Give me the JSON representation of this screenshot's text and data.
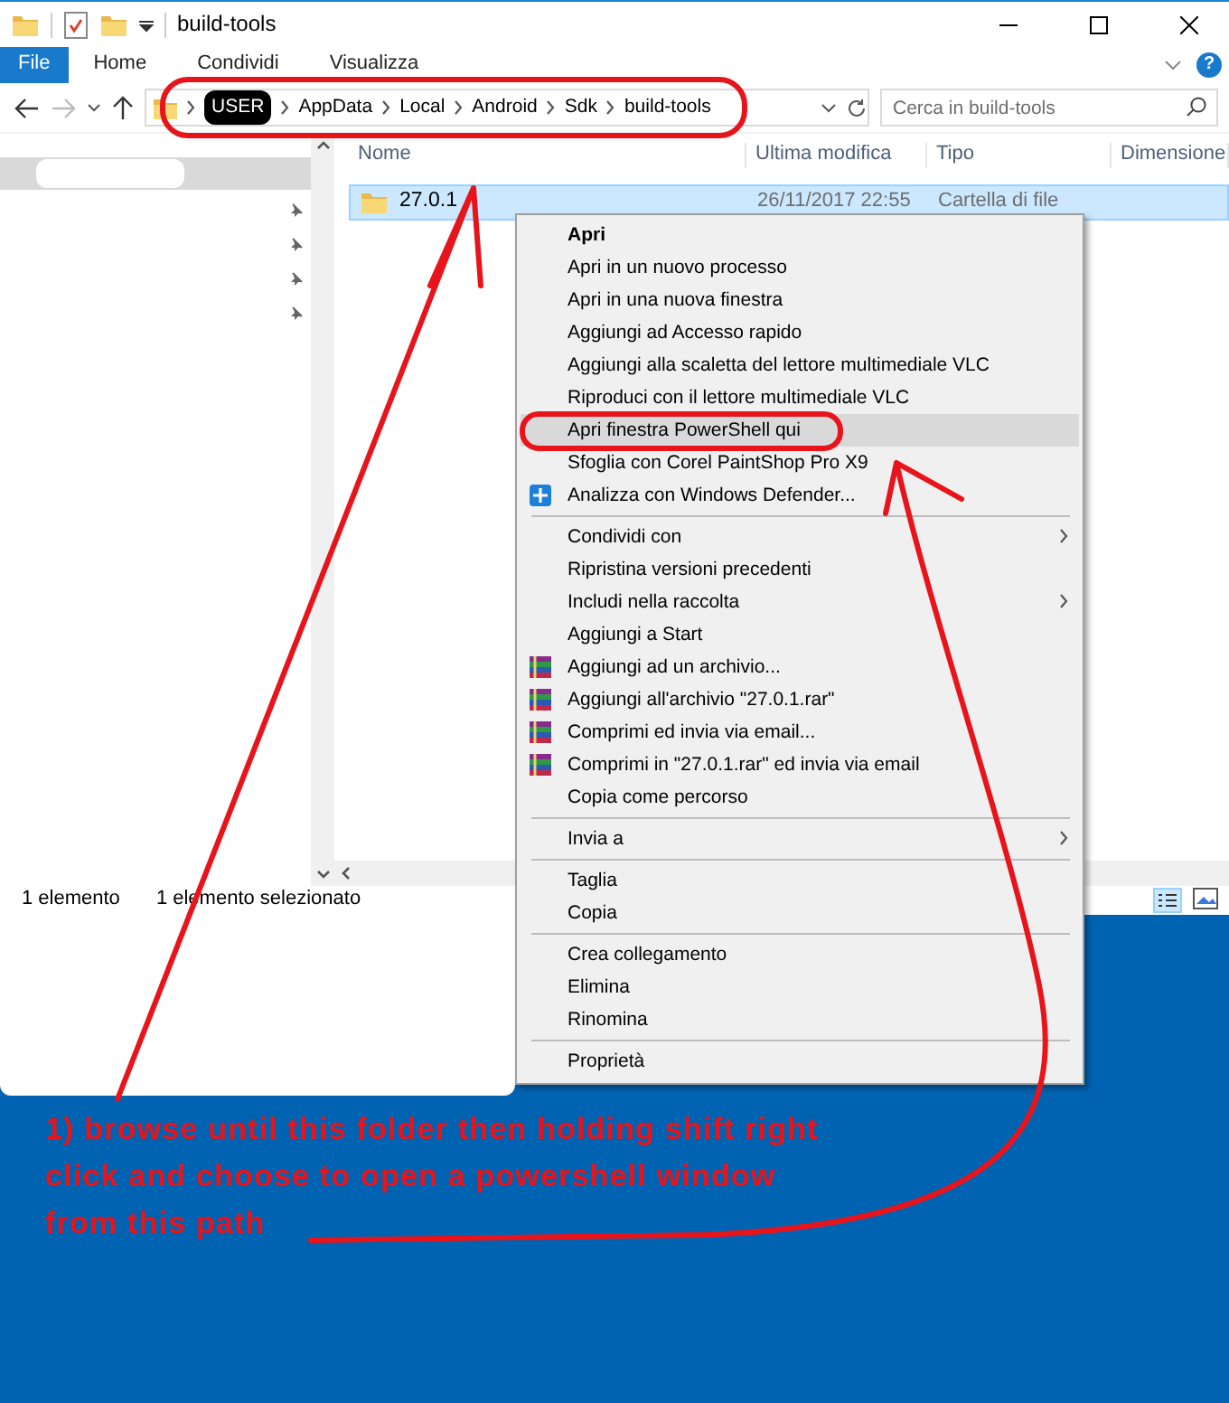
{
  "window": {
    "title": "build-tools"
  },
  "ribbon": {
    "tabs": [
      {
        "label": "File",
        "kind": "file"
      },
      {
        "label": "Home",
        "kind": "tab"
      },
      {
        "label": "Condividi",
        "kind": "tab"
      },
      {
        "label": "Visualizza",
        "kind": "tab"
      }
    ],
    "help": "?"
  },
  "address_bar": {
    "breadcrumbs": [
      {
        "label": "USER",
        "redacted": true
      },
      {
        "label": "AppData",
        "redacted": false
      },
      {
        "label": "Local",
        "redacted": false
      },
      {
        "label": "Android",
        "redacted": false
      },
      {
        "label": "Sdk",
        "redacted": false
      },
      {
        "label": "build-tools",
        "redacted": false
      }
    ]
  },
  "search": {
    "placeholder": "Cerca in build-tools"
  },
  "file_list": {
    "columns": [
      "Nome",
      "Ultima modifica",
      "Tipo",
      "Dimensione"
    ],
    "rows": [
      {
        "name": "27.0.1",
        "modified": "26/11/2017 22:55",
        "type": "Cartella di file",
        "selected": true
      }
    ]
  },
  "status_bar": [
    "1 elemento",
    "1 elemento selezionato"
  ],
  "context_menu": {
    "items": [
      {
        "label": "Apri",
        "kind": "default",
        "selected": false
      },
      {
        "label": "Apri in un nuovo processo",
        "kind": "plain",
        "selected": false
      },
      {
        "label": "Apri in una nuova finestra",
        "kind": "plain",
        "selected": false
      },
      {
        "label": "Aggiungi ad Accesso rapido",
        "kind": "plain",
        "selected": false
      },
      {
        "label": "Aggiungi alla scaletta del lettore multimediale VLC",
        "kind": "plain",
        "selected": false
      },
      {
        "label": "Riproduci con il lettore multimediale VLC",
        "kind": "plain",
        "selected": false
      },
      {
        "label": "Apri finestra PowerShell qui",
        "kind": "plain",
        "selected": true
      },
      {
        "label": "Sfoglia con Corel PaintShop Pro X9",
        "kind": "plain",
        "selected": false
      },
      {
        "label": "Analizza con Windows Defender...",
        "kind": "defender",
        "selected": false
      },
      {
        "kind": "separator"
      },
      {
        "label": "Condividi con",
        "kind": "submenu",
        "selected": false
      },
      {
        "label": "Ripristina versioni precedenti",
        "kind": "plain",
        "selected": false
      },
      {
        "label": "Includi nella raccolta",
        "kind": "submenu",
        "selected": false
      },
      {
        "label": "Aggiungi a Start",
        "kind": "plain",
        "selected": false
      },
      {
        "label": "Aggiungi ad un archivio...",
        "kind": "archive",
        "selected": false
      },
      {
        "label": "Aggiungi all'archivio \"27.0.1.rar\"",
        "kind": "archive",
        "selected": false
      },
      {
        "label": "Comprimi ed invia via email...",
        "kind": "archive",
        "selected": false
      },
      {
        "label": "Comprimi in \"27.0.1.rar\" ed invia via email",
        "kind": "archive",
        "selected": false
      },
      {
        "label": "Copia come percorso",
        "kind": "plain",
        "selected": false
      },
      {
        "kind": "separator"
      },
      {
        "label": "Invia a",
        "kind": "submenu",
        "selected": false
      },
      {
        "kind": "separator"
      },
      {
        "label": "Taglia",
        "kind": "plain",
        "selected": false
      },
      {
        "label": "Copia",
        "kind": "plain",
        "selected": false
      },
      {
        "kind": "separator"
      },
      {
        "label": "Crea collegamento",
        "kind": "plain",
        "selected": false
      },
      {
        "label": "Elimina",
        "kind": "plain",
        "selected": false
      },
      {
        "label": "Rinomina",
        "kind": "plain",
        "selected": false
      },
      {
        "kind": "separator"
      },
      {
        "label": "Proprietà",
        "kind": "plain",
        "selected": false
      }
    ]
  },
  "annotation": {
    "text": "1) browse until this folder then holding shift right\nclick and choose to open a powershell window\nfrom this path"
  }
}
